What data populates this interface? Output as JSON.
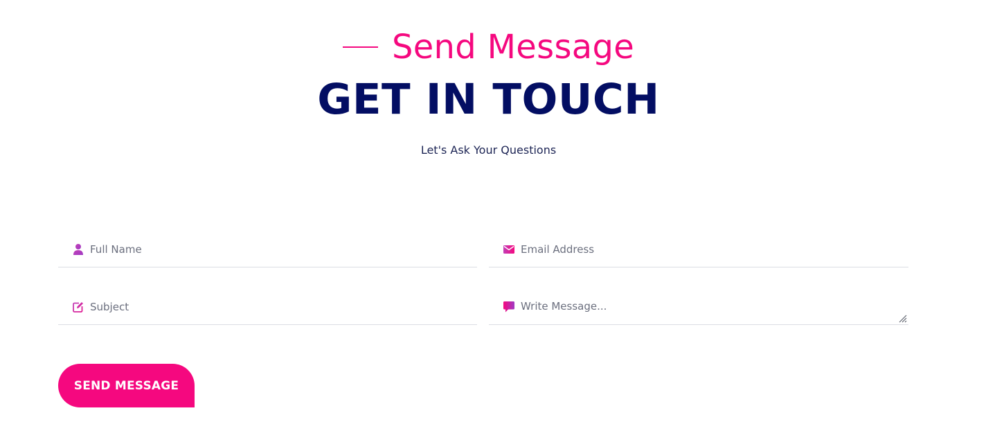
{
  "header": {
    "eyebrow": "Send Message",
    "title": "GET IN TOUCH",
    "subtitle": "Let's Ask Your Questions"
  },
  "form": {
    "full_name": {
      "placeholder": "Full Name",
      "value": "",
      "icon": "user-icon"
    },
    "email": {
      "placeholder": "Email Address",
      "value": "",
      "icon": "envelope-icon"
    },
    "subject": {
      "placeholder": "Subject",
      "value": "",
      "icon": "edit-icon"
    },
    "message": {
      "placeholder": "Write Message...",
      "value": "",
      "icon": "comment-icon"
    },
    "submit_label": "SEND MESSAGE"
  },
  "colors": {
    "accent": "#f5087f",
    "heading": "#030e63",
    "text": "#1c2454",
    "icon_gradient_start": "#c23fb7",
    "icon_gradient_end": "#f5087f"
  }
}
